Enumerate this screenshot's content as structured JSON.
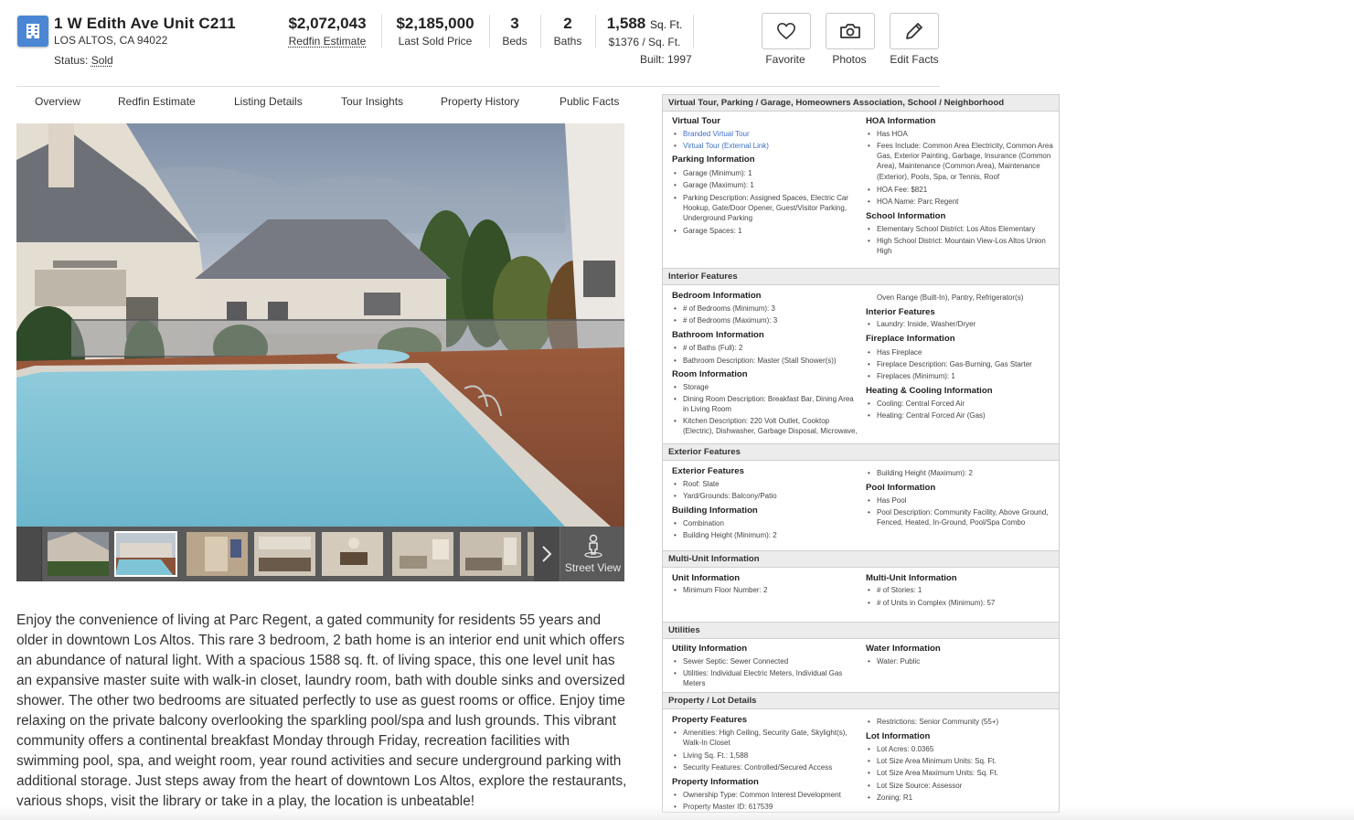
{
  "header": {
    "address_line1": "1 W Edith Ave Unit C211",
    "address_line2": "LOS ALTOS, CA 94022",
    "status_label": "Status:",
    "status_value": "Sold",
    "stats": [
      {
        "value": "$2,072,043",
        "label": "Redfin Estimate"
      },
      {
        "value": "$2,185,000",
        "label": "Last Sold Price"
      },
      {
        "value": "3",
        "label": "Beds"
      },
      {
        "value": "2",
        "label": "Baths"
      }
    ],
    "sqft_value": "1,588",
    "sqft_unit": "Sq. Ft.",
    "price_per_sqft": "$1376 / Sq. Ft.",
    "built": "Built: 1997",
    "actions": [
      {
        "label": "Favorite",
        "icon": "heart-icon"
      },
      {
        "label": "Photos",
        "icon": "camera-icon"
      },
      {
        "label": "Edit Facts",
        "icon": "pencil-icon"
      }
    ]
  },
  "tabs": [
    "Overview",
    "Redfin Estimate",
    "Listing Details",
    "Tour Insights",
    "Property History",
    "Public Facts"
  ],
  "gallery": {
    "street_view_label": "Street View"
  },
  "description": "Enjoy the convenience of living at Parc Regent, a gated community for residents 55 years and older in downtown Los Altos. This rare 3 bedroom, 2 bath home is an interior end unit which offers an abundance of natural light. With a spacious 1588 sq. ft. of living space, this one level unit has an expansive master suite with walk-in closet, laundry room, bath with double sinks and oversized shower. The other two bedrooms are situated perfectly to use as guest rooms or office. Enjoy time relaxing on the private balcony overlooking the sparkling pool/spa and lush grounds. This vibrant community offers a continental breakfast Monday through Friday, recreation facilities with swimming pool, spa, and weight room, year round activities and secure underground parking with additional storage. Just steps away from the heart of downtown Los Altos, explore the restaurants, various shops, visit the library or take in a play, the location is unbeatable!",
  "details": {
    "sections": [
      "Virtual Tour, Parking / Garage, Homeowners Association, School / Neighborhood",
      "Interior Features",
      "Exterior Features",
      "Multi-Unit Information",
      "Utilities",
      "Property / Lot Details"
    ],
    "virtual_tour": {
      "title": "Virtual Tour",
      "items": [
        "Branded Virtual Tour",
        "Virtual Tour (External Link)"
      ]
    },
    "parking": {
      "title": "Parking Information",
      "items": [
        "Garage (Minimum): 1",
        "Garage (Maximum): 1",
        "Parking Description: Assigned Spaces, Electric Car Hookup, Gate/Door Opener, Guest/Visitor Parking, Underground Parking",
        "Garage Spaces: 1"
      ]
    },
    "hoa": {
      "title": "HOA Information",
      "items": [
        "Has HOA",
        "Fees Include: Common Area Electricity, Common Area Gas, Exterior Painting, Garbage, Insurance (Common Area), Maintenance (Common Area), Maintenance (Exterior), Pools, Spa, or Tennis, Roof",
        "HOA Fee: $821",
        "HOA Name: Parc Regent"
      ]
    },
    "school": {
      "title": "School Information",
      "items": [
        "Elementary School District: Los Altos Elementary",
        "High School District: Mountain View-Los Altos Union High"
      ]
    },
    "bedroom": {
      "title": "Bedroom Information",
      "items": [
        "# of Bedrooms (Minimum): 3",
        "# of Bedrooms (Maximum): 3"
      ]
    },
    "bathroom": {
      "title": "Bathroom Information",
      "items": [
        "# of Baths (Full): 2",
        "Bathroom Description: Master (Stall Shower(s))"
      ]
    },
    "room": {
      "title": "Room Information",
      "items": [
        "Storage",
        "Dining Room Description: Breakfast Bar, Dining Area in Living Room",
        "Kitchen Description: 220 Volt Outlet, Cooktop (Electric), Dishwasher, Garbage Disposal, Microwave,"
      ],
      "continued": "Oven Range (Built-In), Pantry, Refrigerator(s)"
    },
    "interior": {
      "title": "Interior Features",
      "items": [
        "Laundry: Inside, Washer/Dryer"
      ]
    },
    "fireplace": {
      "title": "Fireplace Information",
      "items": [
        "Has Fireplace",
        "Fireplace Description: Gas-Burning, Gas Starter",
        "Fireplaces (Minimum): 1"
      ]
    },
    "heating": {
      "title": "Heating & Cooling Information",
      "items": [
        "Cooling: Central Forced Air",
        "Heating: Central Forced Air (Gas)"
      ]
    },
    "exterior": {
      "title": "Exterior Features",
      "items": [
        "Roof: Slate",
        "Yard/Grounds: Balcony/Patio"
      ]
    },
    "building": {
      "title": "Building Information",
      "items": [
        "Combination",
        "Building Height (Minimum): 2"
      ],
      "continued": "Building Height (Maximum): 2"
    },
    "pool": {
      "title": "Pool Information",
      "items": [
        "Has Pool",
        "Pool Description: Community Facility, Above Ground, Fenced, Heated, In-Ground, Pool/Spa Combo"
      ]
    },
    "unit": {
      "title": "Unit Information",
      "items": [
        "Minimum Floor Number: 2"
      ]
    },
    "multi_unit": {
      "title": "Multi-Unit Information",
      "items": [
        "# of Stories: 1",
        "# of Units in Complex (Minimum): 57"
      ]
    },
    "utility": {
      "title": "Utility Information",
      "items": [
        "Sewer Septic: Sewer Connected",
        "Utilities: Individual Electric Meters, Individual Gas Meters"
      ]
    },
    "water": {
      "title": "Water Information",
      "items": [
        "Water: Public"
      ]
    },
    "property_features": {
      "title": "Property Features",
      "items": [
        "Amenities: High Ceiling, Security Gate, Skylight(s), Walk-In Closet",
        "Living Sq. Ft.: 1,588",
        "Security Features: Controlled/Secured Access"
      ],
      "continued": "Restrictions: Senior Community (55+)"
    },
    "property_info": {
      "title": "Property Information",
      "items": [
        "Ownership Type: Common Interest Development",
        "Property Master ID: 617539"
      ]
    },
    "lot": {
      "title": "Lot Information",
      "items": [
        "Lot Acres: 0.0365",
        "Lot Size Area Minimum Units: Sq. Ft.",
        "Lot Size Area Maximum Units: Sq. Ft.",
        "Lot Size Source: Assessor",
        "Zoning: R1"
      ]
    }
  },
  "colors": {
    "accent_blue": "#4b86d4",
    "link_blue": "#3b6fc4",
    "section_header_bg": "#ececec",
    "pool_water": "#7fc4d6"
  }
}
